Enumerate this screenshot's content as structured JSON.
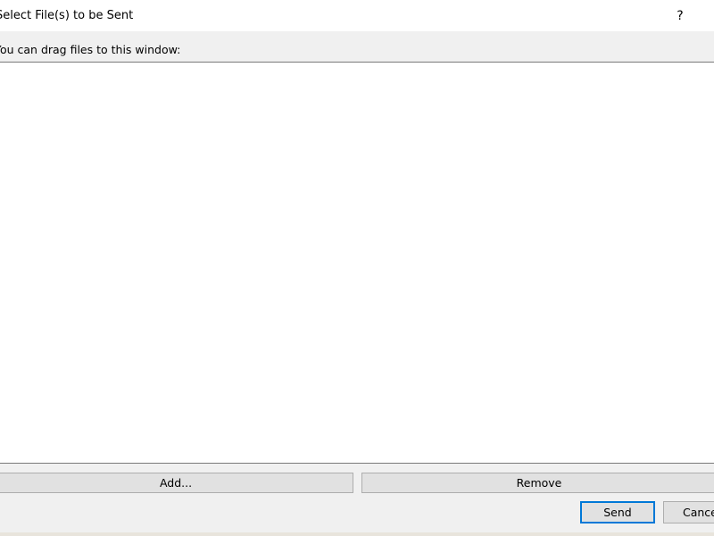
{
  "window": {
    "title": "Select File(s) to be Sent",
    "help_label": "?"
  },
  "main": {
    "drag_hint": "You can drag files to this window:",
    "files": []
  },
  "buttons": {
    "add_label": "Add...",
    "remove_label": "Remove",
    "send_label": "Send",
    "cancel_label": "Cancel"
  },
  "colors": {
    "background": "#f0f0f0",
    "list_background": "#ffffff",
    "button_face": "#e1e1e1",
    "default_button_accent": "#0078d7"
  }
}
